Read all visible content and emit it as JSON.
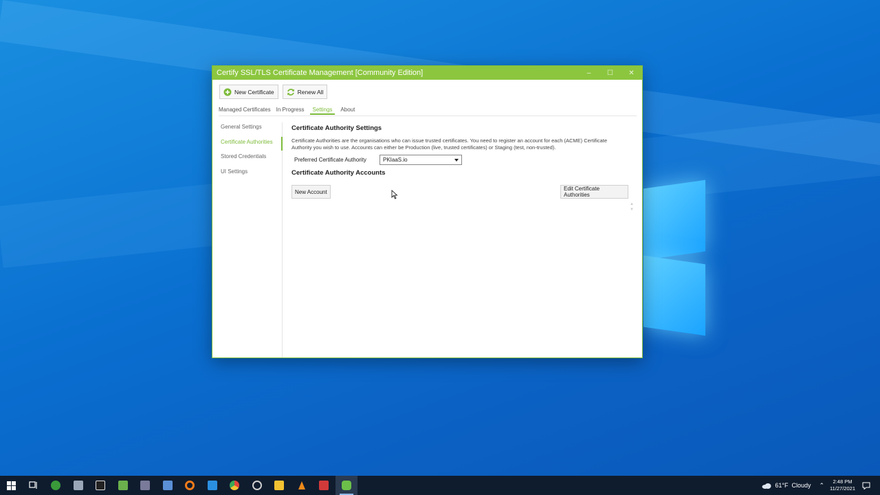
{
  "window": {
    "title": "Certify SSL/TLS Certificate Management [Community Edition]",
    "controls": {
      "minimize": "–",
      "maximize": "☐",
      "close": "✕"
    }
  },
  "toolbar": {
    "new_certificate": "New Certificate",
    "renew_all": "Renew All"
  },
  "tabs": [
    {
      "label": "Managed Certificates",
      "active": false
    },
    {
      "label": "In Progress",
      "active": false
    },
    {
      "label": "Settings",
      "active": true
    },
    {
      "label": "About",
      "active": false
    }
  ],
  "sidenav": [
    {
      "label": "General Settings",
      "active": false
    },
    {
      "label": "Certificate Authorities",
      "active": true
    },
    {
      "label": "Stored Credentials",
      "active": false
    },
    {
      "label": "UI Settings",
      "active": false
    }
  ],
  "main": {
    "heading": "Certificate Authority Settings",
    "description": "Certificate Authorities are the organisations who can issue trusted certificates. You need to register an account for each (ACME) Certificate Authority you wish to use. Accounts can either be Production (live, trusted certificates) or Staging (test, non-trusted).",
    "preferred_label": "Preferred Certificate Authority",
    "preferred_value": "PKIaaS.io",
    "accounts_heading": "Certificate Authority Accounts",
    "new_account": "New Account",
    "edit_authorities": "Edit Certificate Authorities"
  },
  "taskbar": {
    "apps": [
      {
        "icon": "windows-start-icon",
        "color": "#ffffff"
      },
      {
        "icon": "task-view-icon",
        "color": "#ffffff"
      },
      {
        "icon": "hs-app-icon",
        "color": "#3a9a3a"
      },
      {
        "icon": "remote-tool-icon",
        "color": "#9aa7b8"
      },
      {
        "icon": "terminal-icon",
        "color": "#222222"
      },
      {
        "icon": "notepad-icon",
        "color": "#6ab04c"
      },
      {
        "icon": "winrar-icon",
        "color": "#7a7a9a"
      },
      {
        "icon": "remote-desktop-icon",
        "color": "#5b8fd6"
      },
      {
        "icon": "orange-app-icon",
        "color": "#f07a1a"
      },
      {
        "icon": "vscode-icon",
        "color": "#2b8fe0"
      },
      {
        "icon": "chrome-icon",
        "color": "#e0443a"
      },
      {
        "icon": "clock-app-icon",
        "color": "#cfcfcf"
      },
      {
        "icon": "file-explorer-icon",
        "color": "#f2c232"
      },
      {
        "icon": "vlc-icon",
        "color": "#f08a1a"
      },
      {
        "icon": "red-app-icon",
        "color": "#d23a3a"
      },
      {
        "icon": "certify-icon",
        "color": "#6cc04a"
      }
    ],
    "weather": "61°F  Cloudy",
    "time": "2:48 PM",
    "date": "11/27/2021"
  },
  "colors": {
    "accent": "#8cc63f",
    "desktop": "#0a6fd0",
    "taskbar": "#0f1c2e"
  }
}
